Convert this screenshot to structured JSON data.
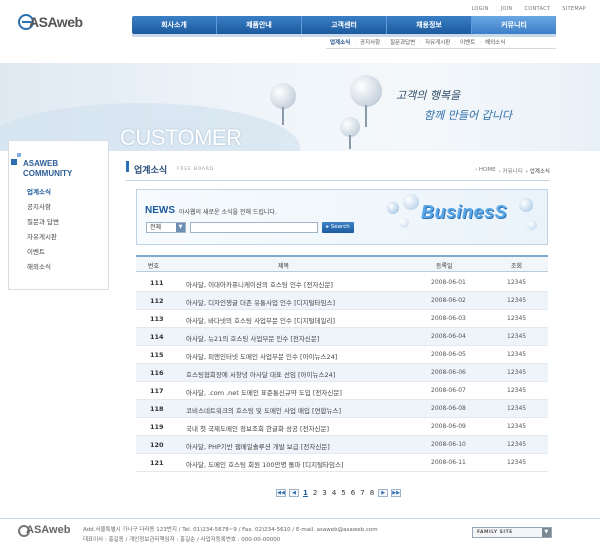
{
  "logo": {
    "text": "ASAweb"
  },
  "util_links": [
    "LOGIN",
    "JOIN",
    "CONTACT",
    "SITEMAP"
  ],
  "gnb": [
    "회사소개",
    "제품안내",
    "고객센터",
    "채용정보",
    "커뮤니티"
  ],
  "subnav": [
    "업계소식",
    "공지사항",
    "질문과답변",
    "자유게시판",
    "이벤트",
    "해외소식"
  ],
  "banner": {
    "title": "CUSTOMER",
    "slogan_line1": "고객의 행복을",
    "slogan_line2": "함께 만들어 갑니다"
  },
  "sidebar": {
    "title_line1": "ASAWEB",
    "title_line2": "COMMUNITY",
    "items": [
      "업계소식",
      "공지사항",
      "질문과 답변",
      "자유게시판",
      "이벤트",
      "해외소식"
    ]
  },
  "page": {
    "title": "업계소식",
    "subtitle": "FREE BOARD",
    "breadcrumb": [
      "› HOME",
      "› 커뮤니티",
      "› 업계소식"
    ]
  },
  "news": {
    "title": "NEWS",
    "desc": "아사웹의 새로운 소식을 전해 드립니다.",
    "select_value": "전체",
    "search_button": "▸ Search",
    "banner_text": "BusinesS"
  },
  "table": {
    "headers": {
      "no": "번호",
      "subject": "제목",
      "date": "등록일",
      "views": "조회"
    },
    "rows": [
      {
        "no": "111",
        "subject": "아사달, 이대아카퓨니케이션의 호스팅 인수 [전자신문]",
        "date": "2008-06-01",
        "views": "12345"
      },
      {
        "no": "112",
        "subject": "아사달, 디자인쟁글 더존 유통사업 인수 [디지털타임스]",
        "date": "2008-06-02",
        "views": "12345"
      },
      {
        "no": "113",
        "subject": "아사달, 바다넷의 호스팅 사업부문 인수 [디지털데일리]",
        "date": "2008-06-03",
        "views": "12345"
      },
      {
        "no": "114",
        "subject": "아사달, 뉴21의 호스팅 사업부문 인수 [전자신문]",
        "date": "2008-06-04",
        "views": "12345"
      },
      {
        "no": "115",
        "subject": "아사달, 피앤인터넷 도메인 사업부문 인수 [아이뉴스24]",
        "date": "2008-06-05",
        "views": "12345"
      },
      {
        "no": "116",
        "subject": "호스팅협회장에 서창녕 아사달 대표 선임 [아이뉴스24]",
        "date": "2008-06-06",
        "views": "12345"
      },
      {
        "no": "117",
        "subject": "아사달, .com .net 도메인 표준통신규약 도입 [전자신문]",
        "date": "2008-06-07",
        "views": "12345"
      },
      {
        "no": "118",
        "subject": "코비스네트워크의 호스팅 및 도메인 사업 매입 [연합뉴스]",
        "date": "2008-06-08",
        "views": "12345"
      },
      {
        "no": "119",
        "subject": "국내 첫 국제도메인 정보조회 한글화 성공 [전자신문]",
        "date": "2008-06-09",
        "views": "12345"
      },
      {
        "no": "120",
        "subject": "아사달, PHP기반 웹메일솔루션 개발 보급 [전자신문]",
        "date": "2008-06-10",
        "views": "12345"
      },
      {
        "no": "121",
        "subject": "아사달, 도메인 호스팅 회원 100만명 돌파 [디지털타임스]",
        "date": "2008-06-11",
        "views": "12345"
      }
    ]
  },
  "paging": {
    "first": "◀◀",
    "prev": "◀",
    "pages": [
      "1",
      "2",
      "3",
      "4",
      "5",
      "6",
      "7",
      "8"
    ],
    "next": "▶",
    "last": "▶▶",
    "current": "1"
  },
  "footer": {
    "logo": "ASAweb",
    "line1": "Add.서울특별시 가나구 다라동 123번지  /  Tel. 01)234-5678~9  /  Fax. 02)234-5610  /  E-mail. asaweb@asaweb.com",
    "line2": "대표이사 : 홍길동 / 개인정보관리책임자 : 홍길순 / 사업자등록번호 : 000-00-00000",
    "family_site": "FAMILY SITE"
  },
  "colors": {
    "accent": "#1c5a9e",
    "nav_bg": "#2d6fb3",
    "row_alt": "#eef4f9"
  }
}
